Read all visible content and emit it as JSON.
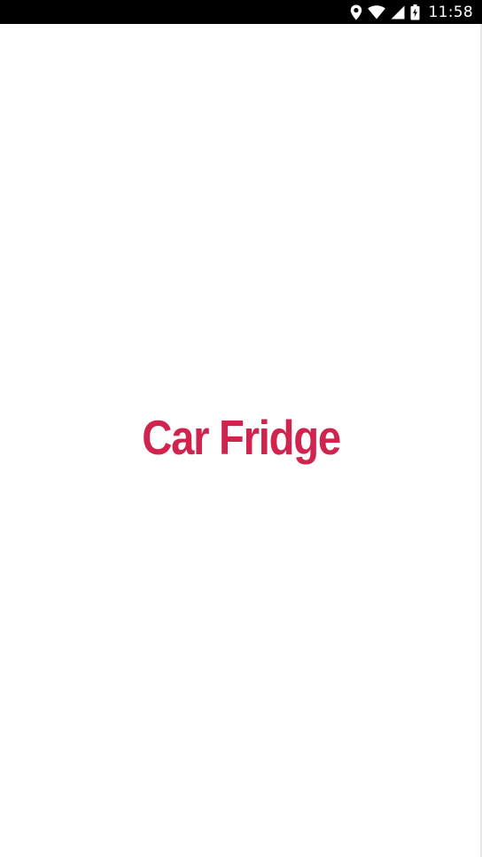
{
  "status_bar": {
    "time": "11:58",
    "icons": [
      "location-icon",
      "wifi-icon",
      "signal-icon",
      "battery-charging-icon"
    ],
    "background": "#000000",
    "foreground": "#ffffff"
  },
  "splash": {
    "logo_text": "Car Fridge",
    "logo_color": "#d0244f",
    "background": "#ffffff"
  }
}
